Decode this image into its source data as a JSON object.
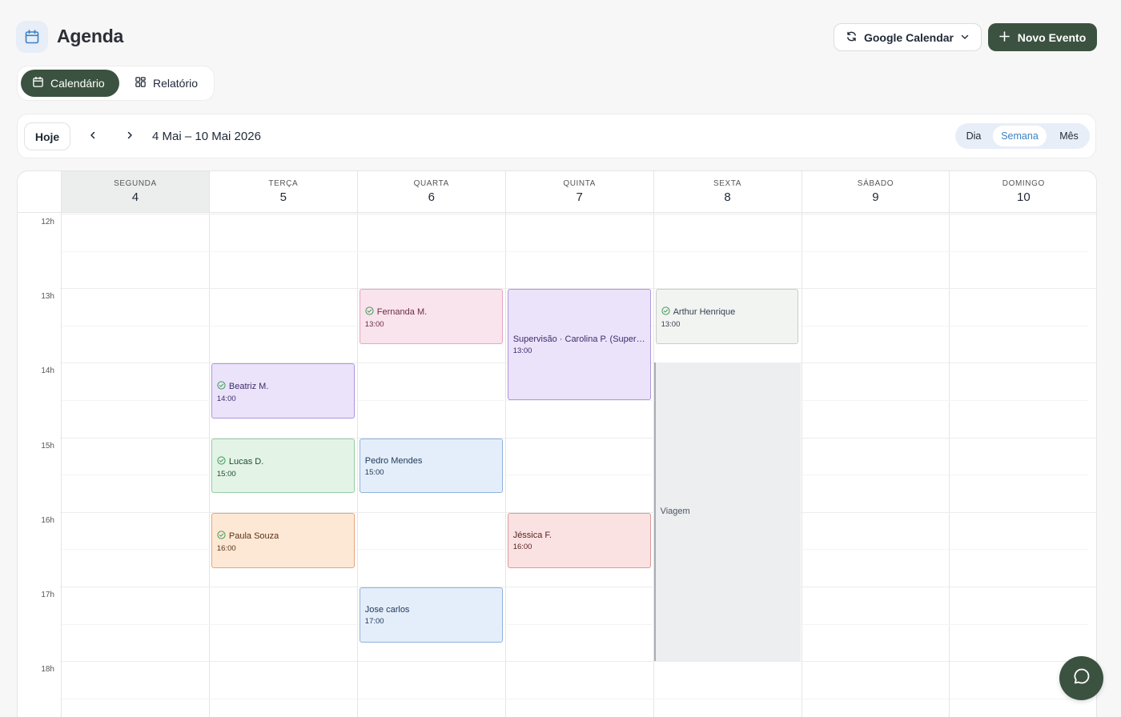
{
  "header": {
    "title": "Agenda",
    "calendar_icon": "calendar-icon",
    "sync_button_label": "Google Calendar",
    "sync_icon": "refresh-icon",
    "new_event_label": "Novo Evento"
  },
  "view_tabs": [
    {
      "label": "Calendário",
      "icon": "calendar-icon",
      "active": true
    },
    {
      "label": "Relatório",
      "icon": "grid-icon",
      "active": false
    }
  ],
  "toolbar": {
    "today_label": "Hoje",
    "range_label": "4 Mai – 10 Mai 2026",
    "modes": [
      {
        "label": "Dia",
        "active": false
      },
      {
        "label": "Semana",
        "active": true
      },
      {
        "label": "Mês",
        "active": false
      }
    ]
  },
  "days": [
    {
      "name": "SEGUNDA",
      "number": "4",
      "today": true
    },
    {
      "name": "TERÇA",
      "number": "5",
      "today": false
    },
    {
      "name": "QUARTA",
      "number": "6",
      "today": false
    },
    {
      "name": "QUINTA",
      "number": "7",
      "today": false
    },
    {
      "name": "SEXTA",
      "number": "8",
      "today": false
    },
    {
      "name": "SÁBADO",
      "number": "9",
      "today": false
    },
    {
      "name": "DOMINGO",
      "number": "10",
      "today": false
    }
  ],
  "hours": [
    "12h",
    "13h",
    "14h",
    "15h",
    "16h",
    "17h",
    "18h"
  ],
  "events": [
    {
      "title": "Fernanda M.",
      "time": "13:00",
      "day": 2,
      "start": 13,
      "duration": 0.75,
      "confirmed": true,
      "color": "pink"
    },
    {
      "title": "Supervisão · Carolina P. (Supervisão)",
      "time": "13:00",
      "day": 3,
      "start": 13,
      "duration": 1.5,
      "confirmed": false,
      "color": "purple",
      "centered": true
    },
    {
      "title": "Arthur Henrique",
      "time": "13:00",
      "day": 4,
      "start": 13,
      "duration": 0.75,
      "confirmed": true,
      "color": "gray"
    },
    {
      "title": "Beatriz M.",
      "time": "14:00",
      "day": 1,
      "start": 14,
      "duration": 0.75,
      "confirmed": true,
      "color": "purple"
    },
    {
      "title": "Lucas D.",
      "time": "15:00",
      "day": 1,
      "start": 15,
      "duration": 0.75,
      "confirmed": true,
      "color": "green"
    },
    {
      "title": "Pedro Mendes",
      "time": "15:00",
      "day": 2,
      "start": 15,
      "duration": 0.75,
      "confirmed": false,
      "color": "blue"
    },
    {
      "title": "Paula Souza",
      "time": "16:00",
      "day": 1,
      "start": 16,
      "duration": 0.75,
      "confirmed": true,
      "color": "orange"
    },
    {
      "title": "Jéssica F.",
      "time": "16:00",
      "day": 3,
      "start": 16,
      "duration": 0.75,
      "confirmed": false,
      "color": "red"
    },
    {
      "title": "Jose carlos",
      "time": "17:00",
      "day": 2,
      "start": 17,
      "duration": 0.75,
      "confirmed": false,
      "color": "blue"
    }
  ],
  "blocked": [
    {
      "label": "Viagem",
      "day": 4,
      "start": 14,
      "end": 18
    }
  ],
  "colors": {
    "accent": "#3c5240",
    "pink": {
      "bg": "#f9e3ec",
      "border": "#e7a6bf",
      "text": "#6b2d45"
    },
    "purple": {
      "bg": "#ebe3fa",
      "border": "#ad97df",
      "text": "#3e2d6b"
    },
    "gray": {
      "bg": "#f1f4f1",
      "border": "#c8cec8",
      "text": "#374151"
    },
    "green": {
      "bg": "#e3f4e7",
      "border": "#95cda2",
      "text": "#1f4a2a"
    },
    "blue": {
      "bg": "#e4eefa",
      "border": "#8db3df",
      "text": "#213a5a"
    },
    "orange": {
      "bg": "#fde8d6",
      "border": "#e7a57a",
      "text": "#5a3216"
    },
    "red": {
      "bg": "#fae2e2",
      "border": "#dc9a9a",
      "text": "#5e2222"
    }
  },
  "chat_fab_icon": "chat-bubble-icon"
}
